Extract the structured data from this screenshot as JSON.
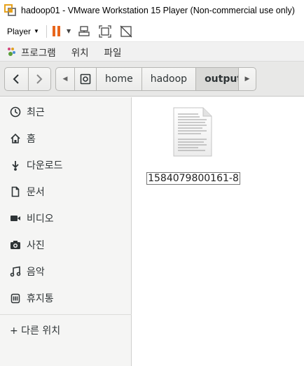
{
  "window": {
    "title": "hadoop01 - VMware Workstation 15 Player (Non-commercial use only)"
  },
  "vm_toolbar": {
    "player_label": "Player",
    "icons": [
      "pause-icon",
      "send-keys-icon",
      "fit-guest-icon",
      "unity-icon"
    ],
    "accent_color": "#e8661c"
  },
  "gnome_menu": {
    "items": [
      "프로그램",
      "위치",
      "파일"
    ]
  },
  "pathbar": {
    "segments": [
      "home",
      "hadoop",
      "output"
    ],
    "current": "output"
  },
  "sidebar": {
    "items": [
      {
        "label": "최근",
        "icon": "clock-icon"
      },
      {
        "label": "홈",
        "icon": "home-icon"
      },
      {
        "label": "다운로드",
        "icon": "download-icon"
      },
      {
        "label": "문서",
        "icon": "document-icon"
      },
      {
        "label": "비디오",
        "icon": "video-icon"
      },
      {
        "label": "사진",
        "icon": "camera-icon"
      },
      {
        "label": "음악",
        "icon": "music-icon"
      },
      {
        "label": "휴지통",
        "icon": "trash-icon"
      }
    ],
    "other_locations": "+ 다른 위치"
  },
  "files": [
    {
      "name": "1584079800161-8",
      "icon": "text-document-icon"
    }
  ]
}
